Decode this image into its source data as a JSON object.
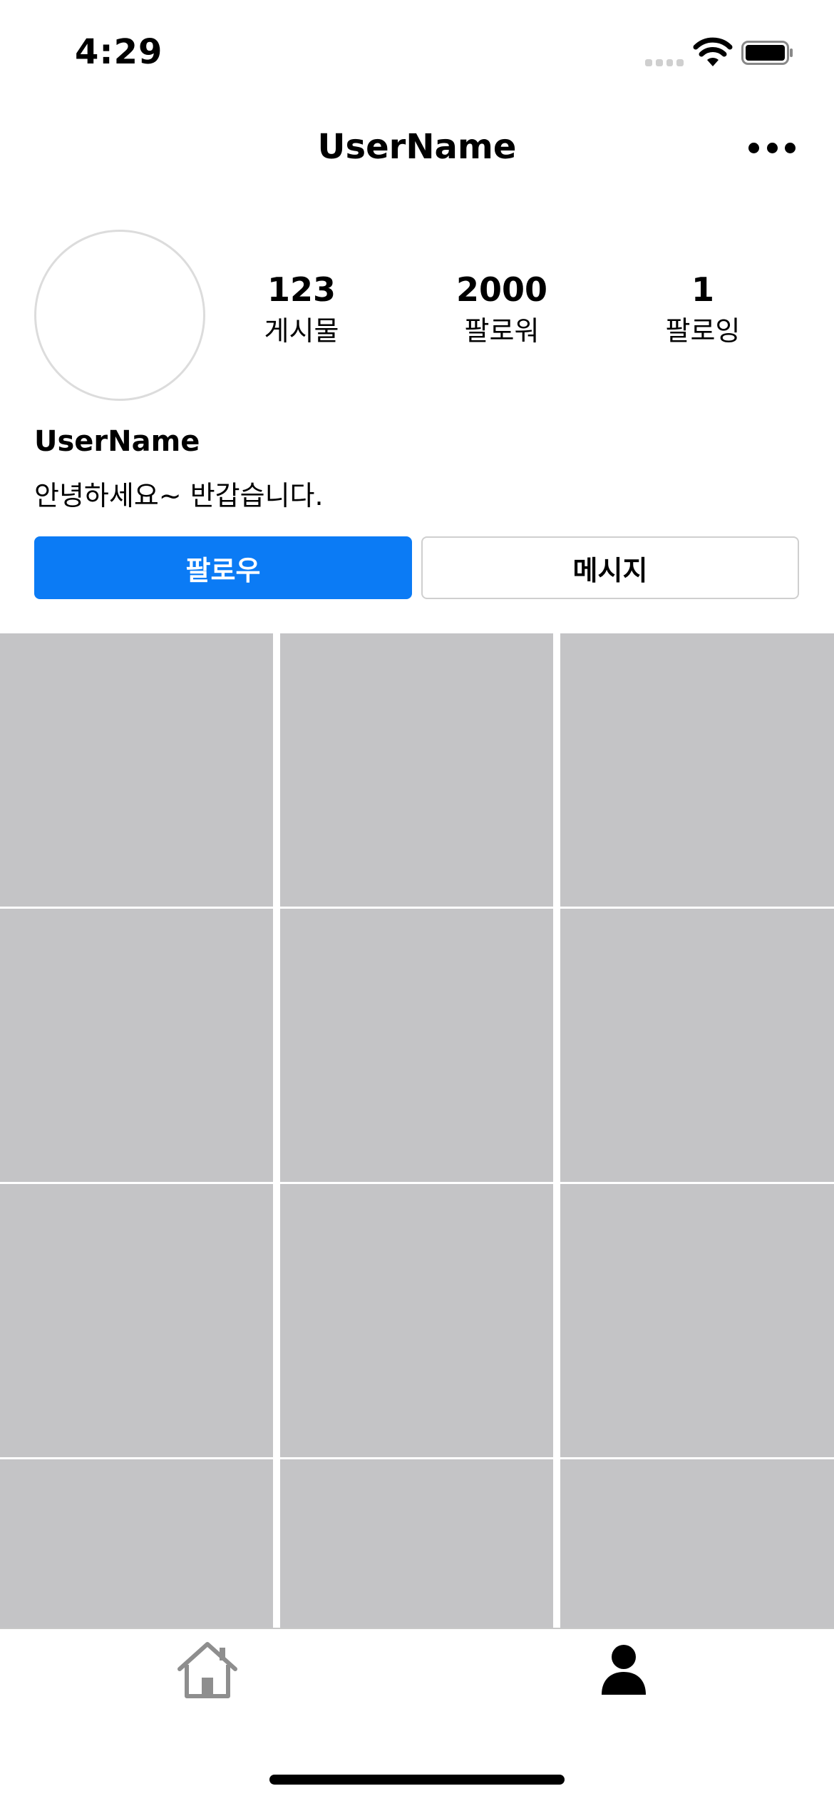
{
  "status_bar": {
    "time": "4:29"
  },
  "nav": {
    "title": "UserName"
  },
  "profile": {
    "stats": [
      {
        "value": "123",
        "label": "게시물"
      },
      {
        "value": "2000",
        "label": "팔로워"
      },
      {
        "value": "1",
        "label": "팔로잉"
      }
    ],
    "name": "UserName",
    "bio": "안녕하세요~ 반갑습니다."
  },
  "actions": {
    "follow_label": "팔로우",
    "message_label": "메시지"
  },
  "colors": {
    "accent": "#0b7bf5",
    "placeholder": "#c4c4c6"
  },
  "icons": {
    "signal": "cellular-signal-icon",
    "wifi": "wifi-icon",
    "battery": "battery-icon",
    "more": "more-icon",
    "home": "home-icon",
    "profile": "person-icon"
  }
}
